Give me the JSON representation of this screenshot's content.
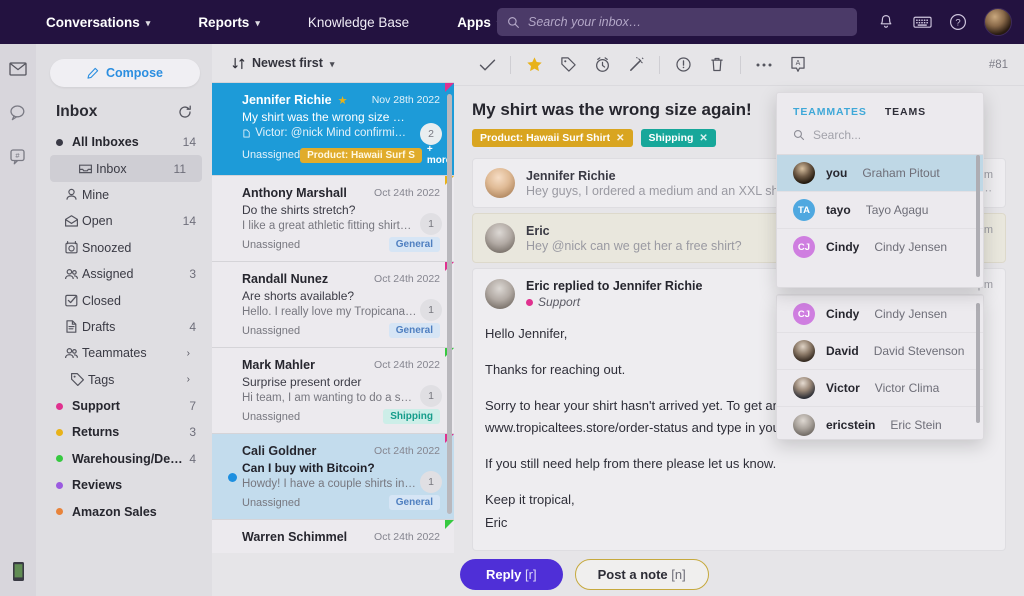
{
  "topbar": {
    "nav": [
      {
        "label": "Conversations",
        "caret": true
      },
      {
        "label": "Reports",
        "caret": true
      },
      {
        "label": "Knowledge Base",
        "caret": false
      },
      {
        "label": "Apps",
        "caret": true
      }
    ],
    "search": {
      "placeholder": "Search your inbox…",
      "value": "",
      "icon": "search-icon"
    },
    "icons": [
      "bell-icon",
      "keyboard-icon",
      "help-icon"
    ],
    "avatar": "user-avatar"
  },
  "rail": {
    "items": [
      "envelope-icon",
      "chat-bubble-icon",
      "hash-bubble-icon"
    ],
    "bottom": "mobile-device-icon"
  },
  "sidebar": {
    "compose_label": "Compose",
    "title": "Inbox",
    "refresh_icon": "refresh-icon",
    "items": [
      {
        "label": "All Inboxes",
        "count": "14",
        "kind": "dot",
        "dot": "#3a3a46",
        "bold": true,
        "selected": false,
        "indent": 0
      },
      {
        "label": "Inbox",
        "count": "11",
        "kind": "icon",
        "icon": "inbox-icon",
        "bold": false,
        "selected": true,
        "indent": 1
      },
      {
        "label": "Mine",
        "count": "",
        "kind": "icon",
        "icon": "person-icon",
        "bold": false,
        "selected": false,
        "indent": 1
      },
      {
        "label": "Open",
        "count": "14",
        "kind": "icon",
        "icon": "open-envelope-icon",
        "bold": false,
        "selected": false,
        "indent": 1
      },
      {
        "label": "Snoozed",
        "count": "",
        "kind": "icon",
        "icon": "snooze-clock-icon",
        "bold": false,
        "selected": false,
        "indent": 1
      },
      {
        "label": "Assigned",
        "count": "3",
        "kind": "icon",
        "icon": "people-icon",
        "bold": false,
        "selected": false,
        "indent": 1
      },
      {
        "label": "Closed",
        "count": "",
        "kind": "icon",
        "icon": "check-square-icon",
        "bold": false,
        "selected": false,
        "indent": 1
      },
      {
        "label": "Drafts",
        "count": "4",
        "kind": "icon",
        "icon": "document-icon",
        "bold": false,
        "selected": false,
        "indent": 1
      },
      {
        "label": "Teammates",
        "count": "",
        "kind": "icon",
        "icon": "people-icon",
        "bold": false,
        "selected": false,
        "indent": 1,
        "chevron": "›"
      },
      {
        "label": "Tags",
        "count": "",
        "kind": "icon",
        "icon": "tag-icon",
        "bold": false,
        "selected": false,
        "indent": 2,
        "chevron": "›"
      },
      {
        "label": "Support",
        "count": "7",
        "kind": "dot",
        "dot": "#e0318f",
        "bold": true,
        "selected": false,
        "indent": 0
      },
      {
        "label": "Returns",
        "count": "3",
        "kind": "dot",
        "dot": "#e8b219",
        "bold": true,
        "selected": false,
        "indent": 0
      },
      {
        "label": "Warehousing/Deli…",
        "count": "4",
        "kind": "dot",
        "dot": "#36c940",
        "bold": true,
        "selected": false,
        "indent": 0
      },
      {
        "label": "Reviews",
        "count": "",
        "kind": "dot",
        "dot": "#9b5ae0",
        "bold": true,
        "selected": false,
        "indent": 0
      },
      {
        "label": "Amazon Sales",
        "count": "",
        "kind": "dot",
        "dot": "#e8833a",
        "bold": true,
        "selected": false,
        "indent": 0
      }
    ]
  },
  "convlist": {
    "sort_label": "Newest first",
    "sort_icon": "sort-icon",
    "items": [
      {
        "name": "Jennifer Richie",
        "starred": true,
        "date": "Nov 28th 2022",
        "subject": "My shirt was the wrong size a…",
        "preview": "Victor: @nick Mind confirmi…",
        "preview_icon": "note-icon",
        "assignee": "Unassigned",
        "tag": "Product: Hawaii Surf S",
        "tag_kind": "gold",
        "more": "+ more",
        "badge": "2",
        "state": "selected-blue",
        "corner": "#e0318f",
        "unread": false
      },
      {
        "name": "Anthony Marshall",
        "starred": false,
        "date": "Oct 24th 2022",
        "subject": "Do the shirts stretch?",
        "preview": "I like a great athletic fitting shirt…",
        "preview_icon": "",
        "assignee": "Unassigned",
        "tag": "General",
        "tag_kind": "general",
        "more": "",
        "badge": "1",
        "state": "normal",
        "corner": "#e8b219",
        "unread": false
      },
      {
        "name": "Randall Nunez",
        "starred": false,
        "date": "Oct 24th 2022",
        "subject": "Are shorts available?",
        "preview": "Hello. I really love my Tropicana…",
        "preview_icon": "",
        "assignee": "Unassigned",
        "tag": "General",
        "tag_kind": "general",
        "more": "",
        "badge": "1",
        "state": "normal",
        "corner": "#e0318f",
        "unread": false
      },
      {
        "name": "Mark Mahler",
        "starred": false,
        "date": "Oct 24th 2022",
        "subject": "Surprise present order",
        "preview": "Hi team, I am wanting to do a s…",
        "preview_icon": "",
        "assignee": "Unassigned",
        "tag": "Shipping",
        "tag_kind": "shipping",
        "more": "",
        "badge": "1",
        "state": "normal",
        "corner": "#36c940",
        "unread": false
      },
      {
        "name": "Cali Goldner",
        "starred": false,
        "date": "Oct 24th 2022",
        "subject": "Can I buy with Bitcoin?",
        "preview": "Howdy! I have a couple shirts in…",
        "preview_icon": "",
        "assignee": "Unassigned",
        "tag": "General",
        "tag_kind": "general",
        "more": "",
        "badge": "1",
        "state": "light-blue",
        "corner": "#e0318f",
        "unread": true
      },
      {
        "name": "Warren Schimmel",
        "starred": false,
        "date": "Oct 24th 2022",
        "subject": "",
        "preview": "",
        "preview_icon": "",
        "assignee": "",
        "tag": "",
        "tag_kind": "",
        "more": "",
        "badge": "",
        "state": "normal",
        "corner": "#36c940",
        "unread": false
      }
    ]
  },
  "main": {
    "toolbar": {
      "icons": [
        "check-icon",
        "star-icon",
        "tag-icon",
        "snooze-icon",
        "magic-wand-icon",
        "exclamation-icon",
        "trash-icon",
        "more-icon",
        "assign-icon"
      ],
      "count": "#81"
    },
    "subject": "My shirt was the wrong size again!",
    "tags": [
      {
        "label": "Product: Hawaii Surf Shirt",
        "color": "#d9a520"
      },
      {
        "label": "Shipping",
        "color": "#17a79a"
      }
    ],
    "messages": [
      {
        "type": "collapsed",
        "avatar": "jennifer-avatar",
        "name": "Jennifer Richie",
        "preview": "Hey guys, I ordered a medium and an XXL showe",
        "time": "pm",
        "dots": "⋯"
      },
      {
        "type": "note",
        "avatar": "eric-avatar",
        "name": "Eric",
        "preview": "Hey @nick can we get her a free shirt?",
        "time": "pm",
        "dots": ""
      }
    ],
    "open_message": {
      "avatar": "eric-avatar",
      "title": "Eric replied to Jennifer Richie",
      "channel": "Support",
      "channel_color": "#e0318f",
      "time": "pm",
      "body": [
        "Hello Jennifer,",
        "Thanks for reaching out.",
        "Sorry to hear your shirt hasn't arrived yet.  To get an update on the status, please visit www.tropicaltees.store/order-status and type in your order number.",
        "If you still need help from there please let us know.",
        "Keep it tropical,\nEric"
      ]
    },
    "reply_label": "Reply",
    "reply_key": "[r]",
    "note_label": "Post a note",
    "note_key": "[n]"
  },
  "teammate_panel": {
    "tabs": [
      {
        "label": "TEAMMATES",
        "active": true
      },
      {
        "label": "TEAMS",
        "active": false
      }
    ],
    "search_placeholder": "Search...",
    "search_icon": "search-icon",
    "front_list": [
      {
        "handle": "you",
        "full": "Graham Pitout",
        "avatar_type": "photo",
        "photo": "graham",
        "selected": true
      },
      {
        "handle": "tayo",
        "full": "Tayo Agagu",
        "avatar_type": "initials",
        "initials": "TA",
        "color": "#4fa8e0",
        "selected": false
      },
      {
        "handle": "Cindy",
        "full": "Cindy Jensen",
        "avatar_type": "initials",
        "initials": "CJ",
        "color": "#cf7ee0",
        "selected": false
      }
    ],
    "back_list": [
      {
        "handle": "Cindy",
        "full": "Cindy Jensen",
        "avatar_type": "initials",
        "initials": "CJ",
        "color": "#cf7ee0",
        "selected": false
      },
      {
        "handle": "David",
        "full": "David Stevenson",
        "avatar_type": "photo",
        "photo": "david",
        "selected": false
      },
      {
        "handle": "Victor",
        "full": "Victor Clima",
        "avatar_type": "photo",
        "photo": "victor",
        "selected": false
      },
      {
        "handle": "ericstein",
        "full": "Eric Stein",
        "avatar_type": "photo",
        "photo": "eric",
        "selected": false
      }
    ]
  }
}
